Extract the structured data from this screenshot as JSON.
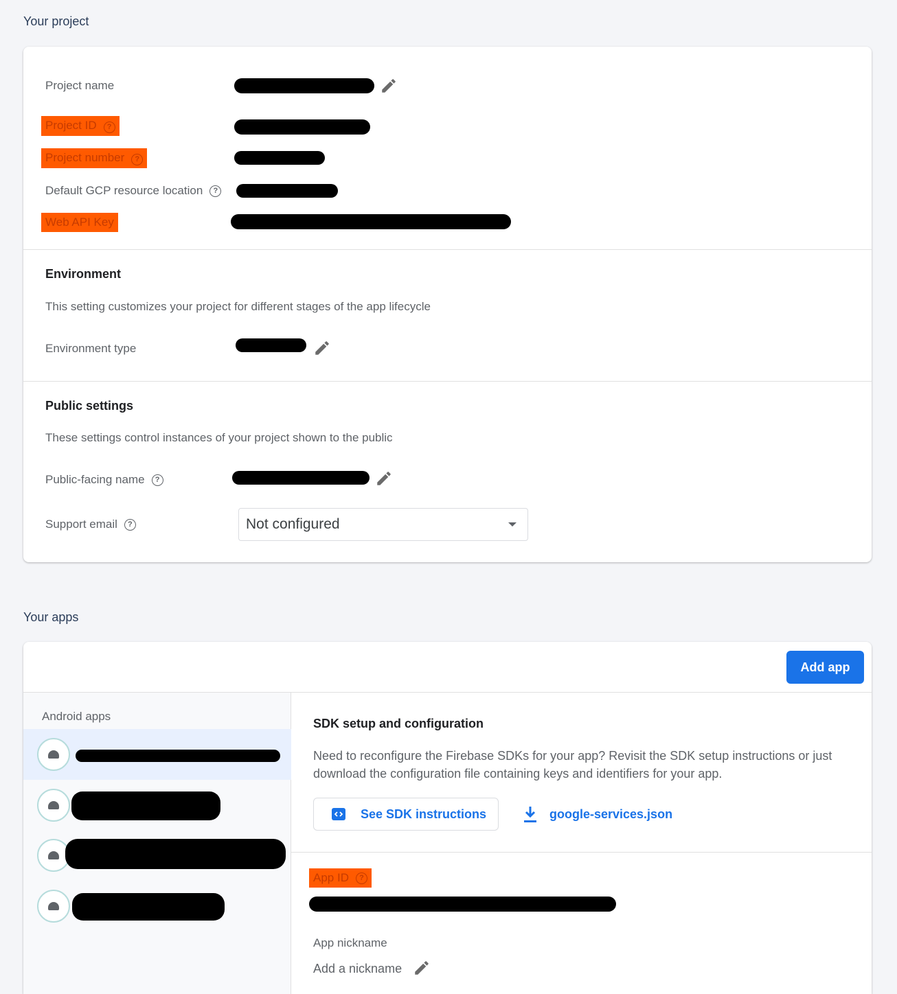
{
  "project_section": {
    "title": "Your project",
    "rows": {
      "project_name": "Project name",
      "project_id": "Project ID",
      "project_number": "Project number",
      "gcp_location": "Default GCP resource location",
      "web_api_key": "Web API Key"
    },
    "environment": {
      "heading": "Environment",
      "description": "This setting customizes your project for different stages of the app lifecycle",
      "type_label": "Environment type"
    },
    "public_settings": {
      "heading": "Public settings",
      "description": "These settings control instances of your project shown to the public",
      "public_name_label": "Public-facing name",
      "support_email_label": "Support email",
      "support_email_value": "Not configured"
    }
  },
  "apps_section": {
    "title": "Your apps",
    "add_app_label": "Add app",
    "android_apps_label": "Android apps",
    "sdk": {
      "heading": "SDK setup and configuration",
      "description_line1": "Need to reconfigure the Firebase SDKs for your app? Revisit the SDK setup instructions or just",
      "description_line2": "download the configuration file containing keys and identifiers for your app.",
      "see_instructions": "See SDK instructions",
      "config_file": "google-services.json"
    },
    "app_id_label": "App ID",
    "app_nickname_label": "App nickname",
    "add_nickname": "Add a nickname"
  },
  "colors": {
    "highlight": "#ff5a00",
    "accent": "#1a73e8",
    "redaction": "#000000"
  },
  "icons": [
    "pencil-icon",
    "help-icon",
    "dropdown-caret-icon",
    "android-icon",
    "code-icon",
    "download-icon"
  ]
}
